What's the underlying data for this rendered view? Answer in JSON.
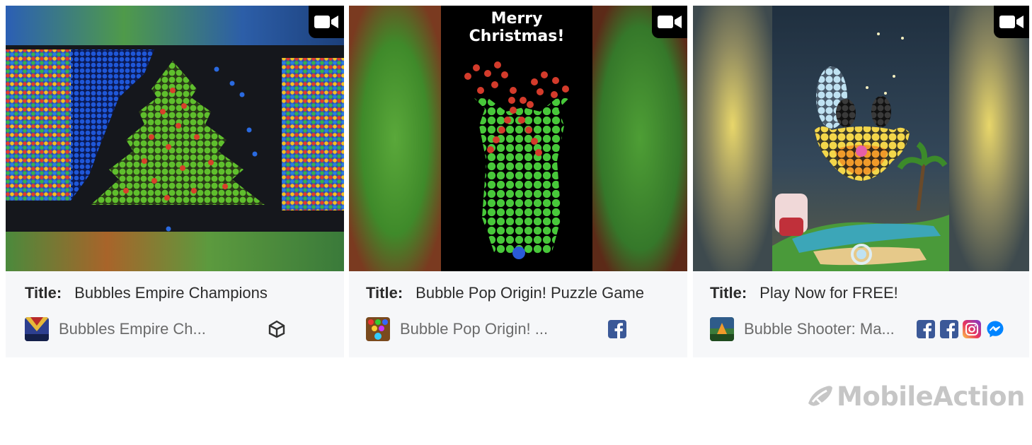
{
  "cards": [
    {
      "title_label": "Title:",
      "title": "Bubbles Empire Champions",
      "app_name": "Bubbles Empire Ch...",
      "networks": [
        "unity-icon"
      ]
    },
    {
      "title_label": "Title:",
      "title": "Bubble Pop Origin! Puzzle Game",
      "app_name": "Bubble Pop Origin! ...",
      "overlay_text": "Merry Christmas!",
      "networks": [
        "facebook-icon"
      ]
    },
    {
      "title_label": "Title:",
      "title": "Play Now for FREE!",
      "app_name": "Bubble Shooter: Ma...",
      "networks": [
        "facebook-icon",
        "facebook-icon",
        "instagram-icon",
        "messenger-icon"
      ]
    }
  ],
  "watermark": "MobileAction",
  "colors": {
    "card_bg": "#f6f7f9",
    "facebook": "#3b5998",
    "instagram": "#d6249f",
    "messenger": "#0084ff",
    "watermark": "#c6c6c6"
  }
}
